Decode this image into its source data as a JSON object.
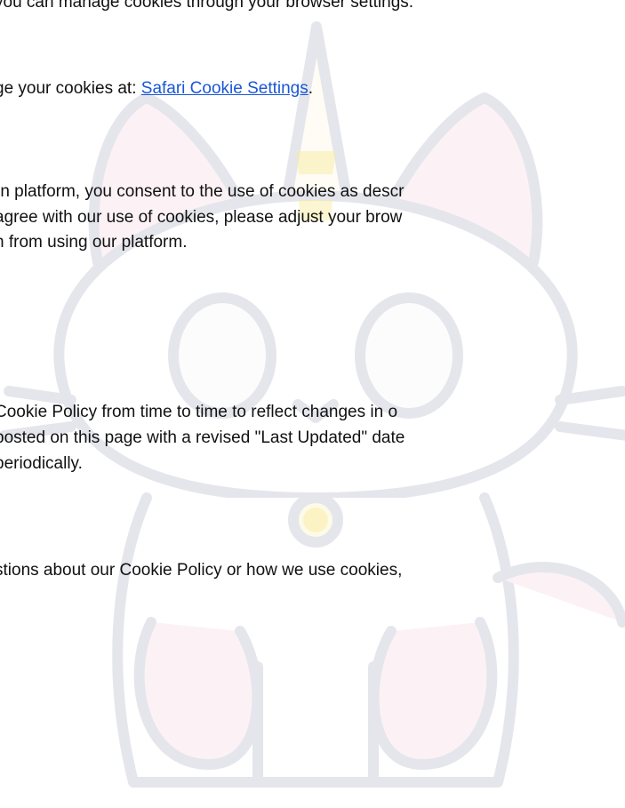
{
  "document": {
    "top_line": "you can manage cookies through your browser settings.",
    "browser_line": {
      "prefix": "ge your cookies at: ",
      "link_label": "Safari Cookie Settings",
      "suffix": "."
    },
    "consent": [
      "rn platform, you consent to the use of cookies as descr",
      "agree with our use of cookies, please adjust your brow",
      "n from using our platform."
    ],
    "changes": [
      " Cookie Policy from time to time to reflect changes in o",
      "posted on this page with a revised \"Last Updated\" date",
      "periodically."
    ],
    "contact": "stions about our Cookie Policy or how we use cookies,"
  },
  "colors": {
    "link": "#1a57d6",
    "watermark_outline": "#c8cad6",
    "watermark_pink": "#f6c9d4",
    "watermark_yellow": "#f8ec9a"
  },
  "watermark": {
    "icon": "unicorn-cat-icon"
  }
}
